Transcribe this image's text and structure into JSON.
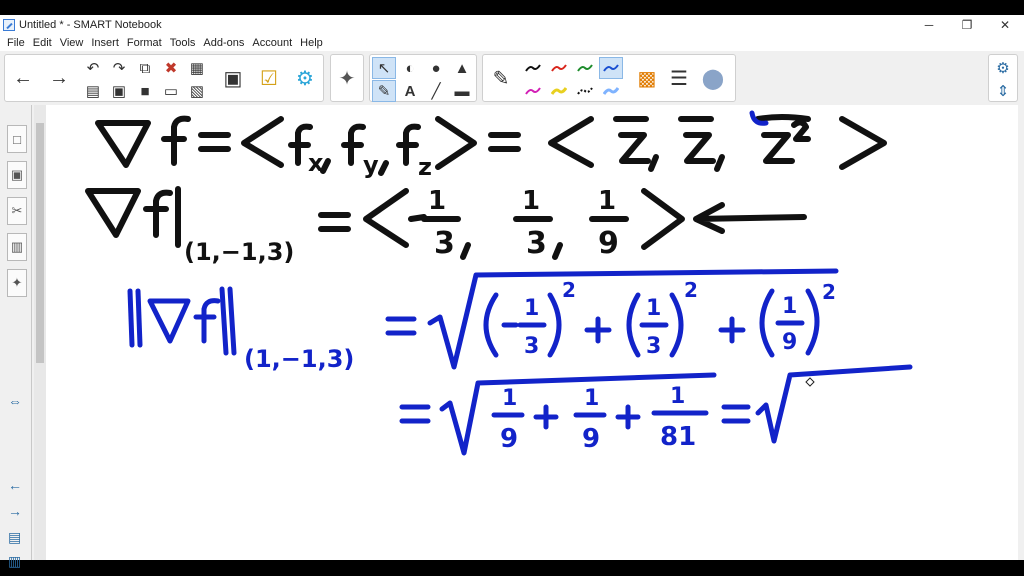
{
  "window": {
    "title": "Untitled * - SMART Notebook",
    "minimize": "─",
    "restore": "❐",
    "close": "✕"
  },
  "menu": [
    "File",
    "Edit",
    "View",
    "Insert",
    "Format",
    "Tools",
    "Add-ons",
    "Account",
    "Help"
  ],
  "toolbar": {
    "icons": [
      "back-arrow-icon",
      "forward-arrow-icon",
      "undo-icon",
      "redo-icon",
      "paste-icon",
      "delete-icon",
      "table-icon",
      "screen-shade-icon",
      "activity-builder-icon",
      "addons-icon",
      "select-icon",
      "pen-icon",
      "text-icon",
      "line-icon",
      "eraser-icon",
      "shapes-icon",
      "fill-icon",
      "settings-gear-icon"
    ],
    "pen_colors": {
      "black": "#111111",
      "red": "#d9261c",
      "green": "#1e8c2c",
      "blue": "#1a4fd1",
      "magenta": "#d21fb5",
      "yellow": "#e8d020"
    }
  },
  "ink": {
    "black_color": "#111111",
    "blue_color": "#1223c9",
    "line1_fx": "x",
    "line1_fy": "y",
    "line1_fz": "z",
    "line2_point": "(1,−1,3)",
    "line2_v1_num": "1",
    "line2_v1_den": "3",
    "line2_v2_num": "1",
    "line2_v2_den": "3",
    "line2_v3_num": "1",
    "line2_v3_den": "9",
    "line3_point": "(1,−1,3)",
    "line3_t1_num": "1",
    "line3_t1_den": "3",
    "line3_t2_num": "1",
    "line3_t2_den": "3",
    "line3_t3_num": "1",
    "line3_t3_den": "9",
    "exp": "2",
    "line4_f1_num": "1",
    "line4_f1_den": "9",
    "line4_f2_num": "1",
    "line4_f2_den": "9",
    "line4_f3_num": "1",
    "line4_f3_den": "81"
  }
}
